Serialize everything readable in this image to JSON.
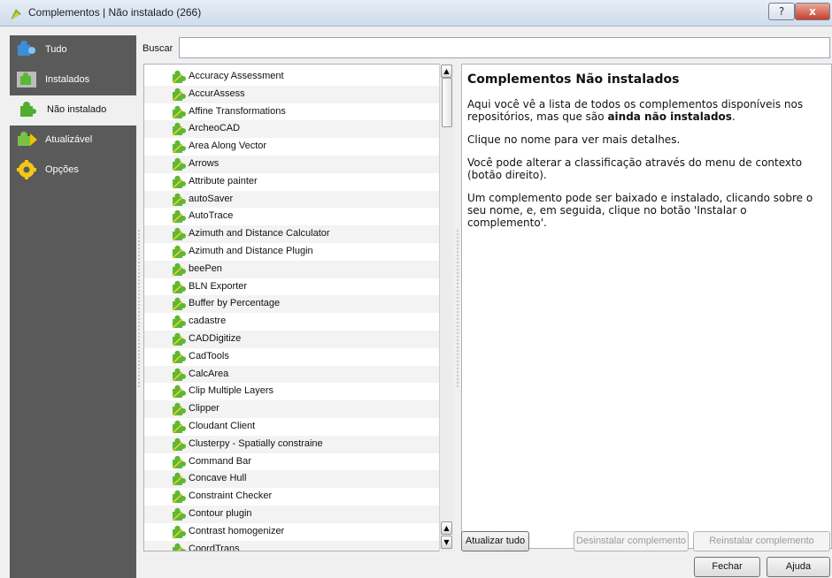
{
  "window": {
    "title": "Complementos | Não instalado (266)",
    "help_label": "?",
    "close_label": "x"
  },
  "sidebar": {
    "items": [
      {
        "label": "Tudo",
        "icon": "puzzle-blue-icon"
      },
      {
        "label": "Instalados",
        "icon": "puzzle-installed-icon"
      },
      {
        "label": "Não instalado",
        "icon": "puzzle-green-icon"
      },
      {
        "label": "Atualizável",
        "icon": "puzzle-upgrade-icon"
      },
      {
        "label": "Opções",
        "icon": "gear-icon"
      }
    ]
  },
  "search": {
    "label": "Buscar",
    "value": ""
  },
  "plugins": [
    "Accuracy Assessment",
    "AccurAssess",
    "Affine Transformations",
    "ArcheoCAD",
    "Area Along Vector",
    "Arrows",
    "Attribute painter",
    "autoSaver",
    "AutoTrace",
    "Azimuth and Distance Calculator",
    "Azimuth and Distance Plugin",
    "beePen",
    "BLN Exporter",
    "Buffer by Percentage",
    "cadastre",
    "CADDigitize",
    "CadTools",
    "CalcArea",
    "Clip Multiple Layers",
    "Clipper",
    "Cloudant Client",
    "Clusterpy - Spatially constraine",
    "Command Bar",
    "Concave Hull",
    "Constraint Checker",
    "Contour plugin",
    "Contrast homogenizer",
    "CoordTrans"
  ],
  "description": {
    "heading": "Complementos Não instalados",
    "p1_before": "Aqui você vê a lista de todos os complementos disponíveis nos repositórios, mas que são ",
    "p1_bold": "ainda não instalados",
    "p1_after": ".",
    "p2": "Clique no nome para ver mais detalhes.",
    "p3": "Você pode alterar a classificação através do menu de contexto (botão direito).",
    "p4": "Um complemento pode ser baixado e instalado, clicando sobre o seu nome, e, em seguida, clique no botão 'Instalar o complemento'."
  },
  "buttons": {
    "refresh": "Atualizar tudo",
    "uninstall": "Desinstalar complemento",
    "reinstall": "Reinstalar complemento",
    "close": "Fechar",
    "help": "Ajuda"
  }
}
